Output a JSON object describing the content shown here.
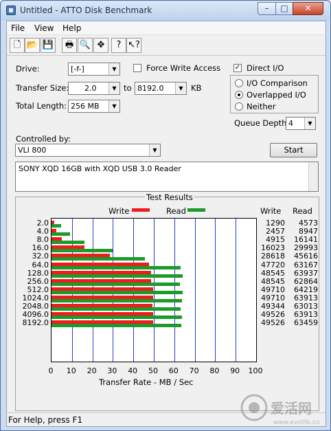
{
  "window": {
    "title": "Untitled - ATTO Disk Benchmark",
    "minimize": "–",
    "maximize": "□",
    "close": "✕"
  },
  "menu": [
    {
      "label": "File"
    },
    {
      "label": "View"
    },
    {
      "label": "Help"
    }
  ],
  "toolbar": {
    "icons": [
      "new-icon",
      "open-icon",
      "save-icon",
      "print-icon",
      "print-preview-icon",
      "move-icon",
      "help-icon",
      "context-help-icon"
    ],
    "glyphs": [
      "🗋",
      "📂",
      "💾",
      "🖶",
      "🔍",
      "✥",
      "?",
      "↖?"
    ]
  },
  "settings": {
    "drive_label": "Drive:",
    "drive_value": "[-f-]",
    "force_write_label": "Force Write Access",
    "force_write_checked": false,
    "direct_io_label": "Direct I/O",
    "direct_io_checked": true,
    "transfer_size_label": "Transfer Size:",
    "transfer_from": "2.0",
    "to_label": "to",
    "transfer_to": "8192.0",
    "unit": "KB",
    "total_length_label": "Total Length:",
    "total_length": "256 MB",
    "io_comparison_label": "I/O Comparison",
    "overlapped_io_label": "Overlapped I/O",
    "neither_label": "Neither",
    "io_mode_selected": "Overlapped I/O",
    "queue_depth_label": "Queue Depth:",
    "queue_depth": "4",
    "controlled_by_label": "Controlled by:",
    "controller": "VLI 800",
    "start_label": "Start",
    "description": "SONY XQD 16GB with XQD USB 3.0 Reader",
    "check_mark": "✓",
    "dropdown_glyph": "▼"
  },
  "results": {
    "group_title": "Test Results",
    "legend_write": "Write",
    "legend_read": "Read",
    "col_write": "Write",
    "col_read": "Read",
    "write_color": "#ee1c1c",
    "read_color": "#1c9a2a",
    "xlabel": "Transfer Rate - MB / Sec"
  },
  "chart_data": {
    "type": "bar",
    "orientation": "horizontal",
    "title": "Test Results",
    "xlabel": "Transfer Rate - MB / Sec",
    "xlim": [
      0,
      100
    ],
    "xticks": [
      "0",
      "10",
      "20",
      "30",
      "40",
      "50",
      "60",
      "70",
      "80",
      "90",
      "100"
    ],
    "categories": [
      "2.0",
      "4.0",
      "8.0",
      "16.0",
      "32.0",
      "64.0",
      "128.0",
      "256.0",
      "512.0",
      "1024.0",
      "2048.0",
      "4096.0",
      "8192.0"
    ],
    "series": [
      {
        "name": "Write",
        "color": "#ee1c1c",
        "values": [
          1.29,
          2.457,
          4.915,
          16.023,
          28.618,
          47.72,
          48.545,
          48.545,
          49.71,
          49.71,
          49.344,
          49.526,
          49.526
        ],
        "labels": [
          "1290",
          "2457",
          "4915",
          "16023",
          "28618",
          "47720",
          "48545",
          "48545",
          "49710",
          "49710",
          "49344",
          "49526",
          "49526"
        ]
      },
      {
        "name": "Read",
        "color": "#1c9a2a",
        "values": [
          4.573,
          8.947,
          16.141,
          29.993,
          45.616,
          63.167,
          63.937,
          62.864,
          64.219,
          63.913,
          63.013,
          63.913,
          63.459
        ],
        "labels": [
          "4573",
          "8947",
          "16141",
          "29993",
          "45616",
          "63167",
          "63937",
          "62864",
          "64219",
          "63913",
          "63013",
          "63913",
          "63459"
        ]
      }
    ],
    "grid": true,
    "legend": "top"
  },
  "status": {
    "text": "For Help, press F1"
  },
  "watermark": {
    "text": "爱活网",
    "url": "www.evolife.cn"
  }
}
